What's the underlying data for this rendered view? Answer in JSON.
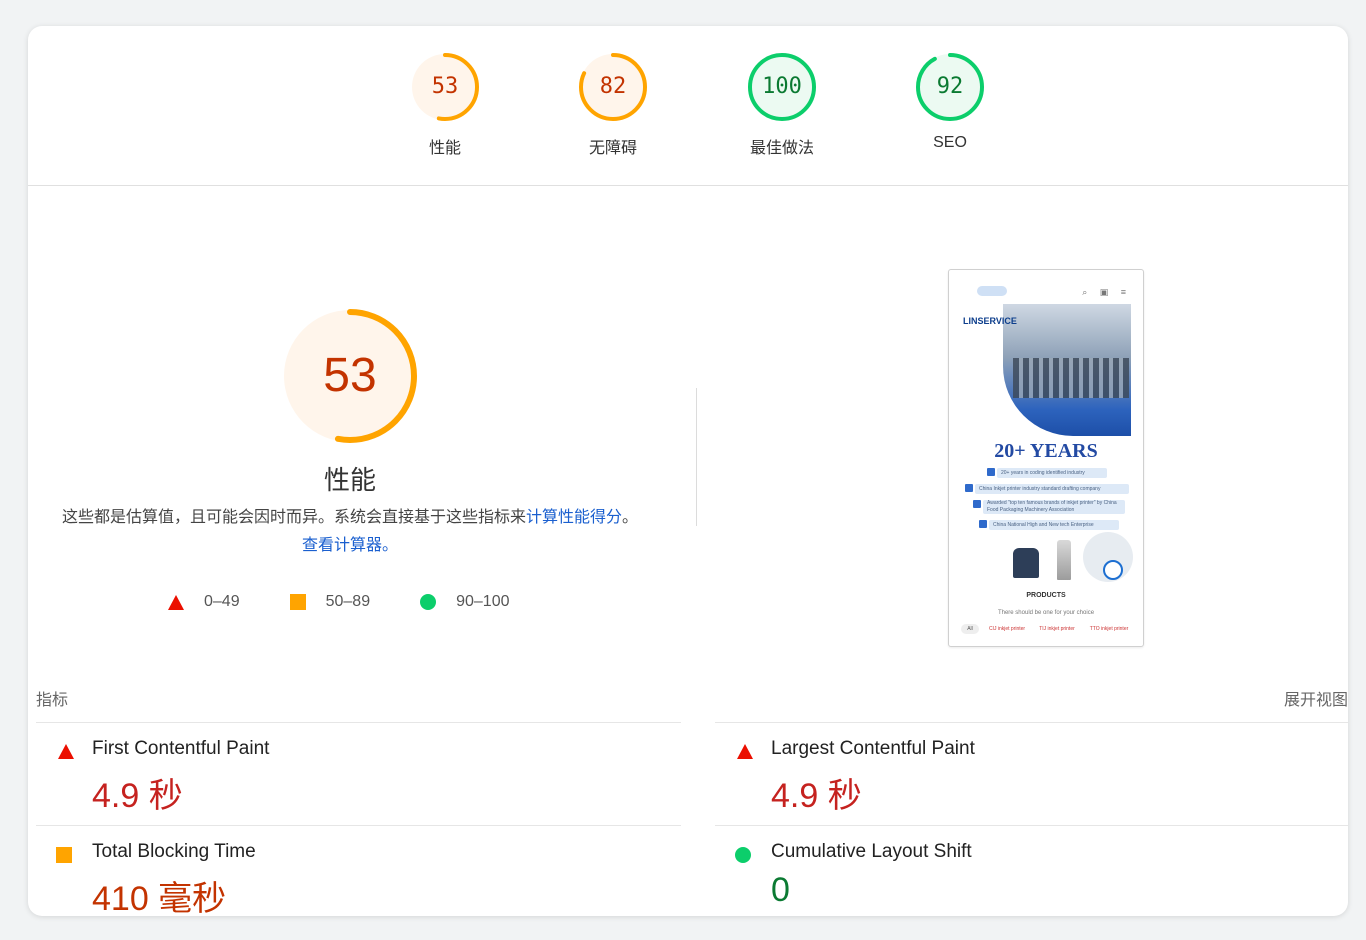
{
  "categories": [
    {
      "score": "53",
      "label": "性能",
      "status": "average",
      "color": "#ffa400",
      "fraction": 0.53
    },
    {
      "score": "82",
      "label": "无障碍",
      "status": "average",
      "color": "#ffa400",
      "fraction": 0.82
    },
    {
      "score": "100",
      "label": "最佳做法",
      "status": "pass",
      "color": "#0cce6b",
      "fraction": 1.0
    },
    {
      "score": "92",
      "label": "SEO",
      "status": "pass",
      "color": "#0cce6b",
      "fraction": 0.92
    }
  ],
  "performance": {
    "score": "53",
    "fraction": 0.53,
    "title": "性能",
    "desc_text": "这些都是估算值，且可能会因时而异。系统会直接基于这些指标来",
    "desc_link1": "计算性能得分",
    "desc_sep": "。",
    "desc_link2": "查看计算器。"
  },
  "legend": [
    {
      "icon": "fail-triangle-icon",
      "range": "0–49",
      "color": "#eb0f00"
    },
    {
      "icon": "average-square-icon",
      "range": "50–89",
      "color": "#ffa400"
    },
    {
      "icon": "pass-circle-icon",
      "range": "90–100",
      "color": "#0cce6b"
    }
  ],
  "thumbnail": {
    "brand": "LINSERVICE",
    "years": "20+ YEARS",
    "bullets": [
      "20+ years in coding identified industry",
      "China Inkjet printer industry standard drafting company",
      "Awarded \"top ten famous brands of inkjet printer\" by China Food Packaging Machinery Association",
      "China National High and New tech Enterprise"
    ],
    "products": "PRODUCTS",
    "choice": "There should be one for your choice",
    "chips": [
      "All",
      "CIJ inkjet printer",
      "TIJ inkjet printer",
      "TTO inkjet printer"
    ]
  },
  "metrics": {
    "label": "指标",
    "expand": "展开视图",
    "items": [
      {
        "name": "First Contentful Paint",
        "value": "4.9 秒",
        "status": "fail",
        "icon": "fail-triangle-icon"
      },
      {
        "name": "Largest Contentful Paint",
        "value": "4.9 秒",
        "status": "fail",
        "icon": "fail-triangle-icon"
      },
      {
        "name": "Total Blocking Time",
        "value": "410 毫秒",
        "status": "average",
        "icon": "average-square-icon"
      },
      {
        "name": "Cumulative Layout Shift",
        "value": "0",
        "status": "pass",
        "icon": "pass-circle-icon"
      }
    ]
  }
}
